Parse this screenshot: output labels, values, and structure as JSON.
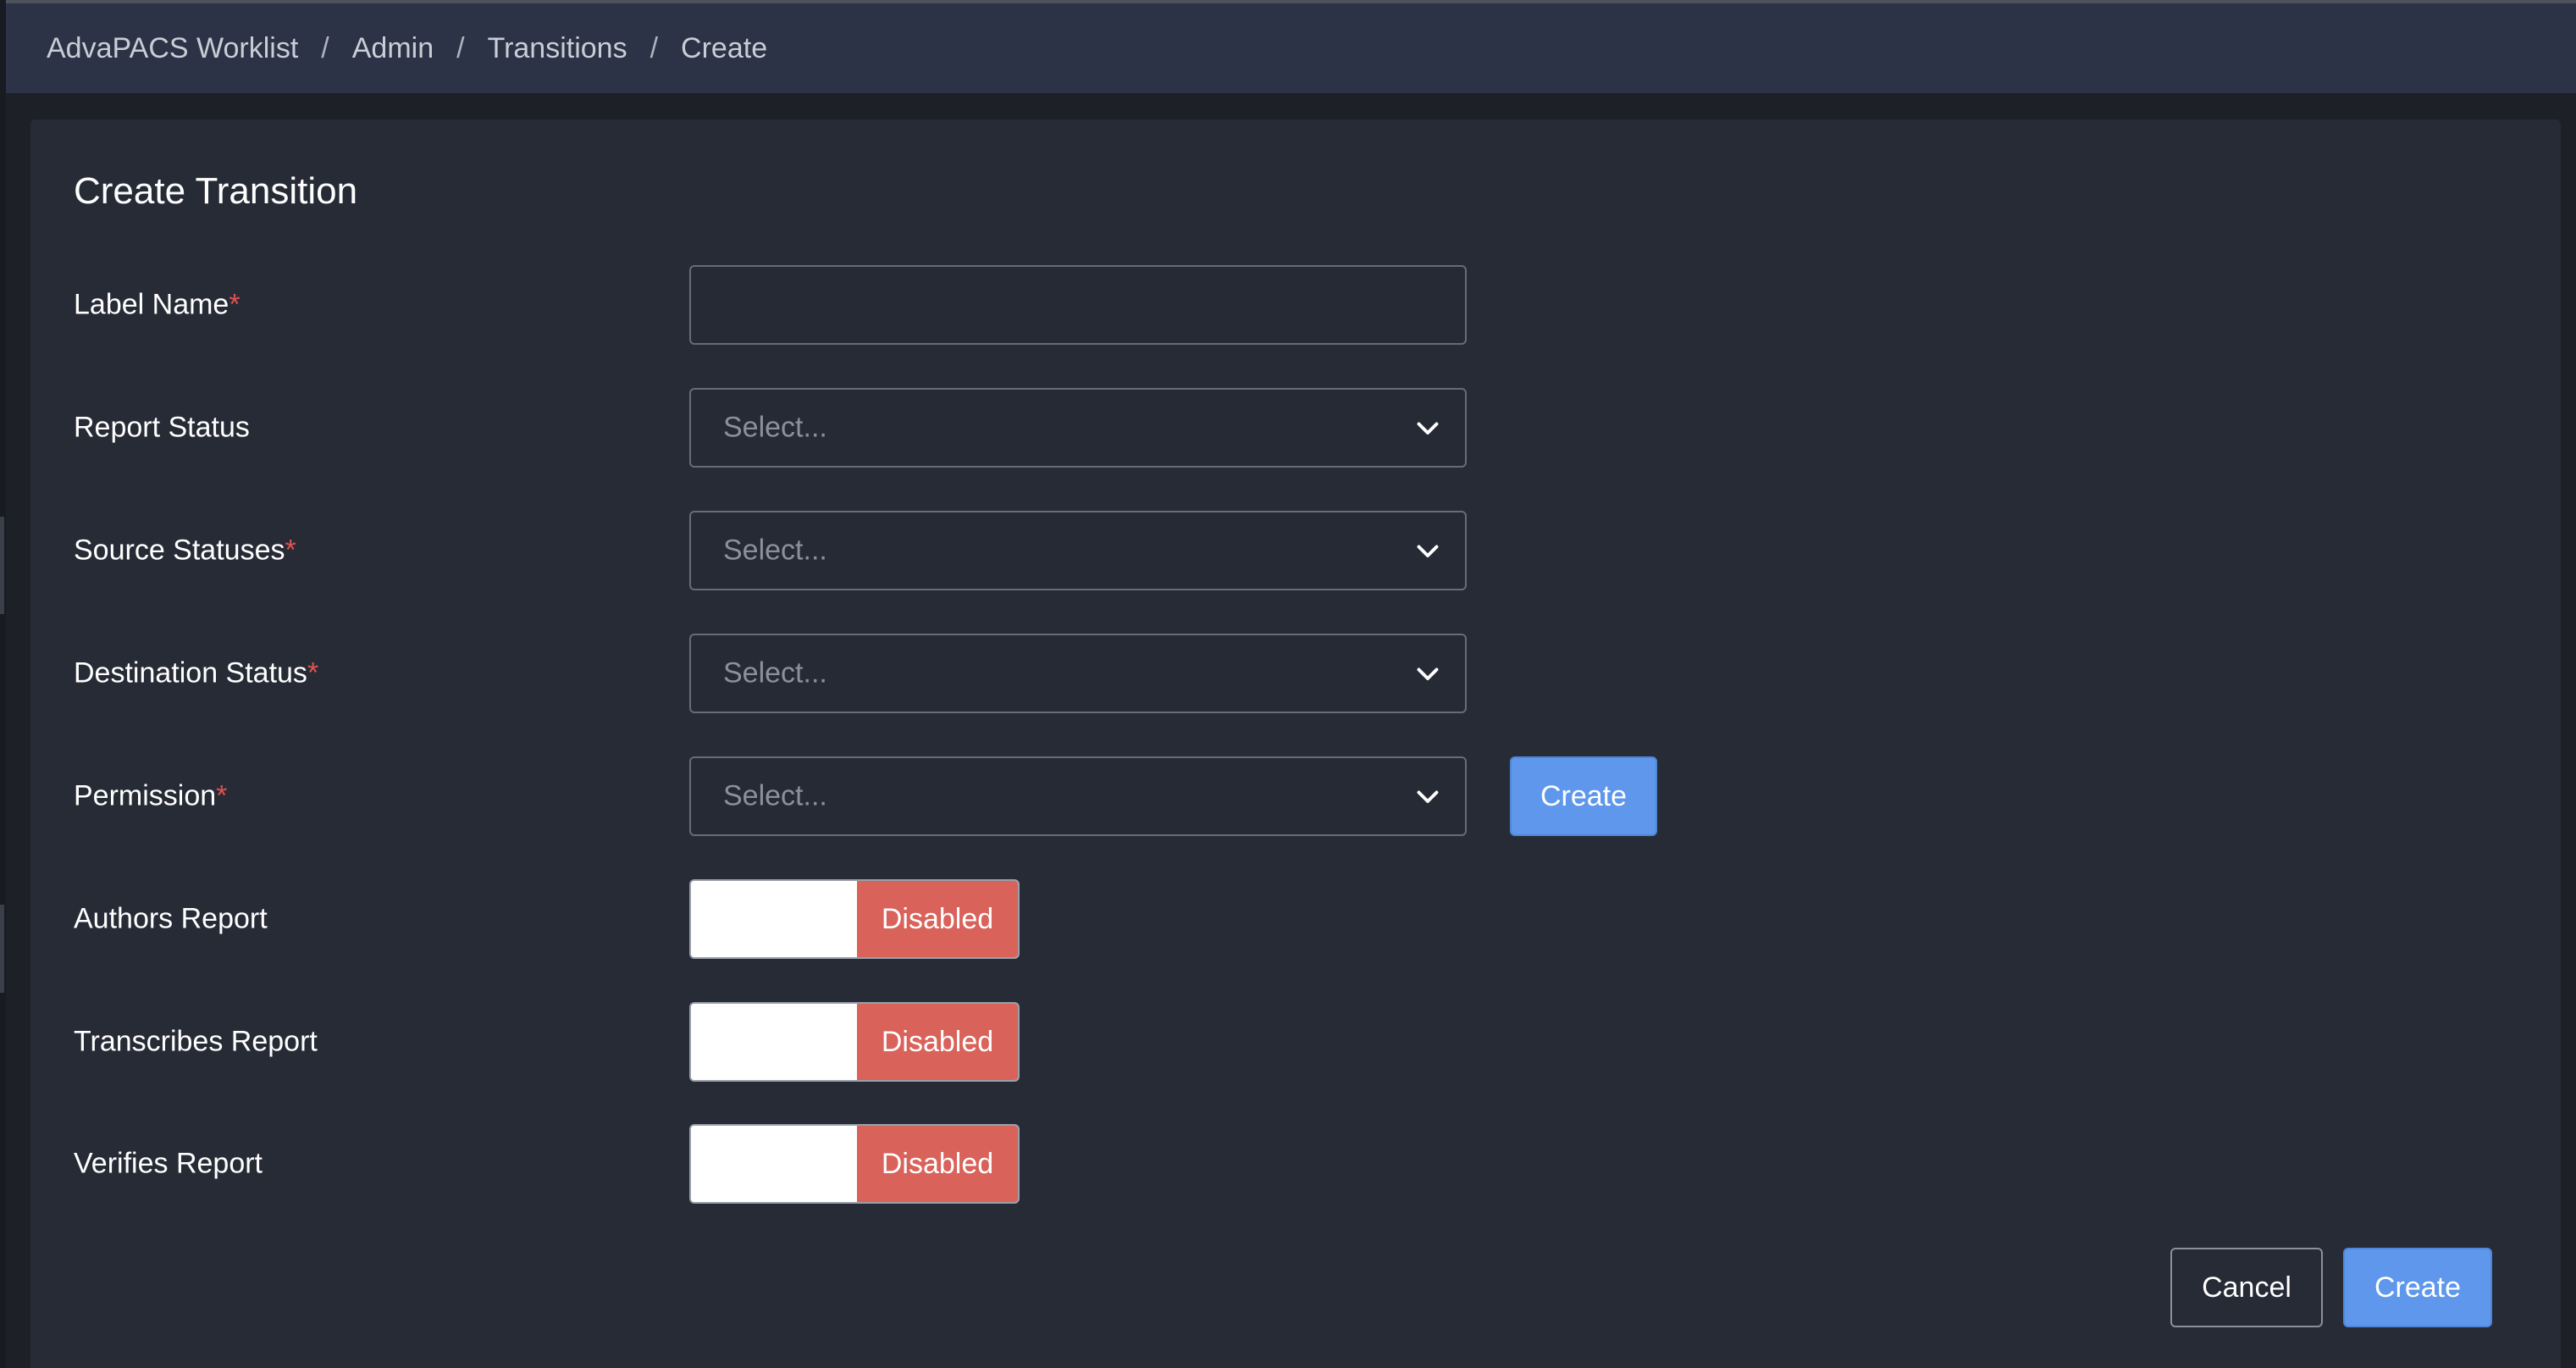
{
  "breadcrumb": {
    "items": [
      "AdvaPACS Worklist",
      "Admin",
      "Transitions",
      "Create"
    ],
    "separator": "/"
  },
  "form": {
    "title": "Create Transition",
    "required_marker": "*",
    "label_name": {
      "label": "Label Name",
      "value": "",
      "required": true
    },
    "report_status": {
      "label": "Report Status",
      "placeholder": "Select...",
      "required": false
    },
    "source_statuses": {
      "label": "Source Statuses",
      "placeholder": "Select...",
      "required": true
    },
    "destination_status": {
      "label": "Destination Status",
      "placeholder": "Select...",
      "required": true
    },
    "permission": {
      "label": "Permission",
      "placeholder": "Select...",
      "required": true,
      "create_label": "Create"
    },
    "authors_report": {
      "label": "Authors Report",
      "state": "Disabled"
    },
    "transcribes_report": {
      "label": "Transcribes Report",
      "state": "Disabled"
    },
    "verifies_report": {
      "label": "Verifies Report",
      "state": "Disabled"
    }
  },
  "actions": {
    "cancel_label": "Cancel",
    "create_label": "Create"
  },
  "icons": {
    "select_chevron": "chevron-down-icon"
  },
  "colors": {
    "header_bg": "#2c3346",
    "panel_bg": "#272b36",
    "primary": "#5e97ec",
    "disabled": "#d9625a",
    "required": "#e0524f"
  }
}
